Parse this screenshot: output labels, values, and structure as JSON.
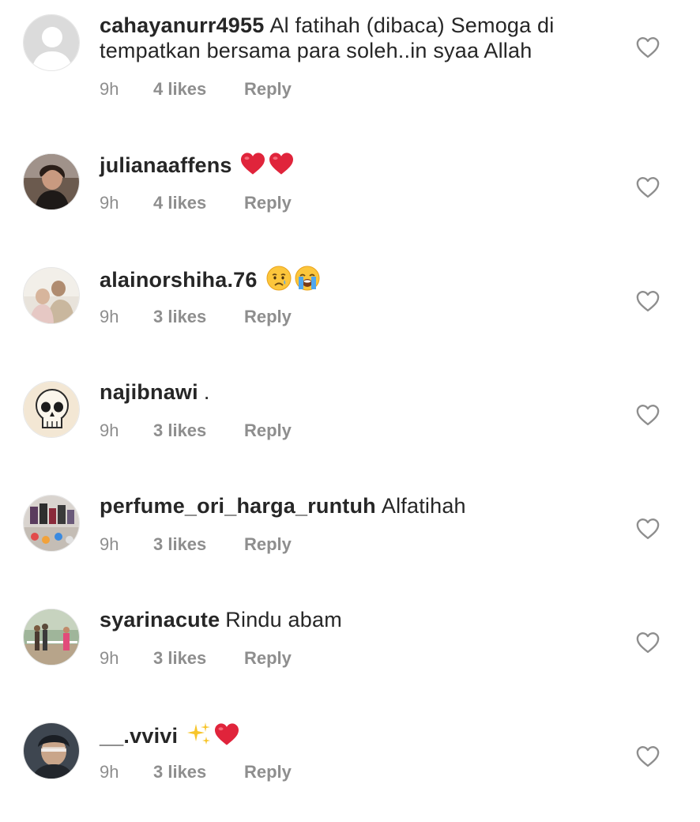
{
  "comments": [
    {
      "username": "cahayanurr4955",
      "text": "Al fatihah (dibaca) Semoga di tempatkan bersama para soleh..in syaa Allah",
      "time": "9h",
      "likes": "4 likes",
      "reply": "Reply",
      "avatar": "default-avatar-icon"
    },
    {
      "username": "julianaaffens",
      "text": "",
      "emojis": [
        "red-heart-emoji",
        "red-heart-emoji"
      ],
      "time": "9h",
      "likes": "4 likes",
      "reply": "Reply",
      "avatar": "profile-photo"
    },
    {
      "username": "alainorshiha.76",
      "text": "",
      "emojis": [
        "crying-face-emoji",
        "loudly-crying-face-emoji"
      ],
      "time": "9h",
      "likes": "3 likes",
      "reply": "Reply",
      "avatar": "profile-photo"
    },
    {
      "username": "najibnawi",
      "text": ".",
      "time": "9h",
      "likes": "3 likes",
      "reply": "Reply",
      "avatar": "skull-profile-photo"
    },
    {
      "username": "perfume_ori_harga_runtuh",
      "text": "Alfatihah",
      "time": "9h",
      "likes": "3 likes",
      "reply": "Reply",
      "avatar": "profile-photo"
    },
    {
      "username": "syarinacute",
      "text": "Rindu abam",
      "time": "9h",
      "likes": "3 likes",
      "reply": "Reply",
      "avatar": "profile-photo"
    },
    {
      "username": "__.vvivi",
      "text": "",
      "emojis": [
        "sparkles-emoji",
        "red-heart-emoji"
      ],
      "time": "9h",
      "likes": "3 likes",
      "reply": "Reply",
      "avatar": "profile-photo"
    }
  ],
  "colors": {
    "username": "#262626",
    "meta": "#8e8e8e",
    "heart_outline": "#8e8e8e",
    "red_heart": "#e0243b"
  }
}
